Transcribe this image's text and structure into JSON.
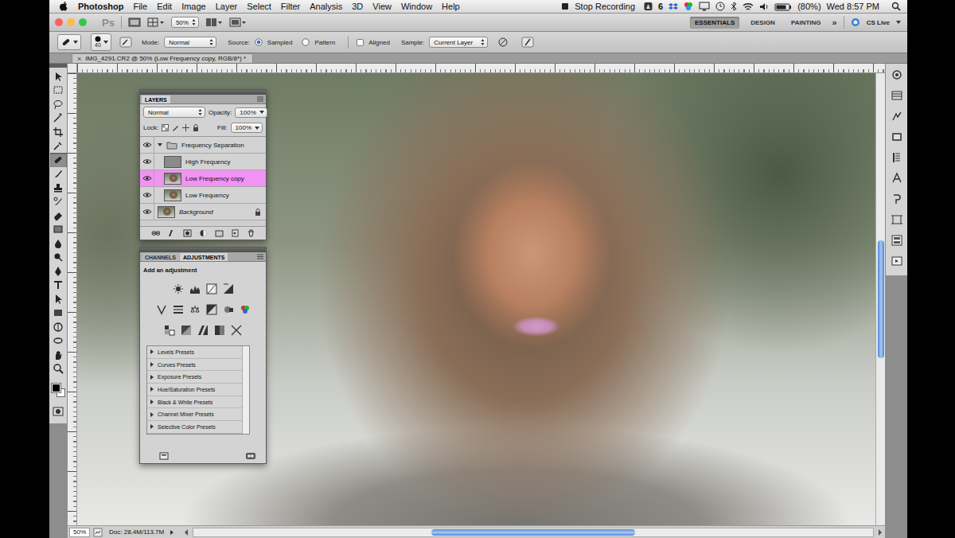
{
  "menubar": {
    "app": "Photoshop",
    "items": [
      "File",
      "Edit",
      "Image",
      "Layer",
      "Select",
      "Filter",
      "Analysis",
      "3D",
      "View",
      "Window",
      "Help"
    ],
    "recording": "Stop Recording",
    "badge": "6",
    "battery_level": 0.8,
    "battery": "(80%)",
    "clock": "Wed 8:57 PM"
  },
  "appbar": {
    "logo": "Ps",
    "zoom": "50%",
    "workspaces": [
      {
        "label": "ESSENTIALS",
        "selected": true
      },
      {
        "label": "DESIGN",
        "selected": false
      },
      {
        "label": "PAINTING",
        "selected": false
      }
    ],
    "more": "»",
    "cs_live": "CS Live"
  },
  "options_bar": {
    "brush_size": "40",
    "mode_label": "Mode:",
    "mode": "Normal",
    "source_label": "Source:",
    "sources": [
      {
        "label": "Sampled",
        "selected": true
      },
      {
        "label": "Pattern",
        "selected": false
      }
    ],
    "aligned": {
      "label": "Aligned",
      "checked": false
    },
    "sample_label": "Sample:",
    "sample": "Current Layer"
  },
  "document": {
    "title": "IMG_4291.CR2 @ 50% (Low Frequency copy, RGB/8*) *",
    "close": "×"
  },
  "tools": [
    {
      "selected": false
    },
    {
      "selected": false
    },
    {
      "selected": false
    },
    {
      "selected": false
    },
    {
      "selected": false
    },
    {
      "selected": false
    },
    {
      "selected": true
    },
    {
      "selected": false
    },
    {
      "selected": false
    },
    {
      "selected": false
    },
    {
      "selected": false
    },
    {
      "selected": false
    },
    {
      "selected": false
    },
    {
      "selected": false
    },
    {
      "selected": false
    },
    {
      "selected": false
    },
    {
      "selected": false
    },
    {
      "selected": false
    },
    {
      "selected": false
    },
    {
      "selected": false
    },
    {
      "selected": false
    },
    {
      "selected": false
    }
  ],
  "layers_panel": {
    "tab": "LAYERS",
    "blend": "Normal",
    "opacity_label": "Opacity:",
    "opacity": "100%",
    "lock_label": "Lock:",
    "fill_label": "Fill:",
    "fill": "100%",
    "layers": [
      {
        "name": "Frequency Separation",
        "kind": "group",
        "expanded": true,
        "visible": true,
        "selected": false,
        "locked": false,
        "in_group": false
      },
      {
        "name": "High Frequency",
        "kind": "neutral",
        "visible": true,
        "selected": false,
        "locked": false,
        "in_group": true
      },
      {
        "name": "Low Frequency copy",
        "kind": "photo",
        "visible": true,
        "selected": true,
        "locked": false,
        "in_group": true
      },
      {
        "name": "Low Frequency",
        "kind": "photo",
        "visible": true,
        "selected": false,
        "locked": false,
        "in_group": true
      },
      {
        "name": "Background",
        "kind": "background",
        "visible": true,
        "selected": false,
        "locked": true,
        "in_group": false
      }
    ]
  },
  "adjustments_panel": {
    "tabs": [
      {
        "label": "CHANNELS",
        "selected": false
      },
      {
        "label": "ADJUSTMENTS",
        "selected": true
      }
    ],
    "heading": "Add an adjustment",
    "presets": [
      "Levels Presets",
      "Curves Presets",
      "Exposure Presets",
      "Hue/Saturation Presets",
      "Black & White Presets",
      "Channel Mixer Presets",
      "Selective Color Presets"
    ]
  },
  "vertical_scroll": {
    "level": 0.26
  },
  "status_bar": {
    "zoom": "50%",
    "doc_size": "Doc: 28.4M/113.7M",
    "horizontal_scroll": {
      "level": 0.3
    }
  }
}
